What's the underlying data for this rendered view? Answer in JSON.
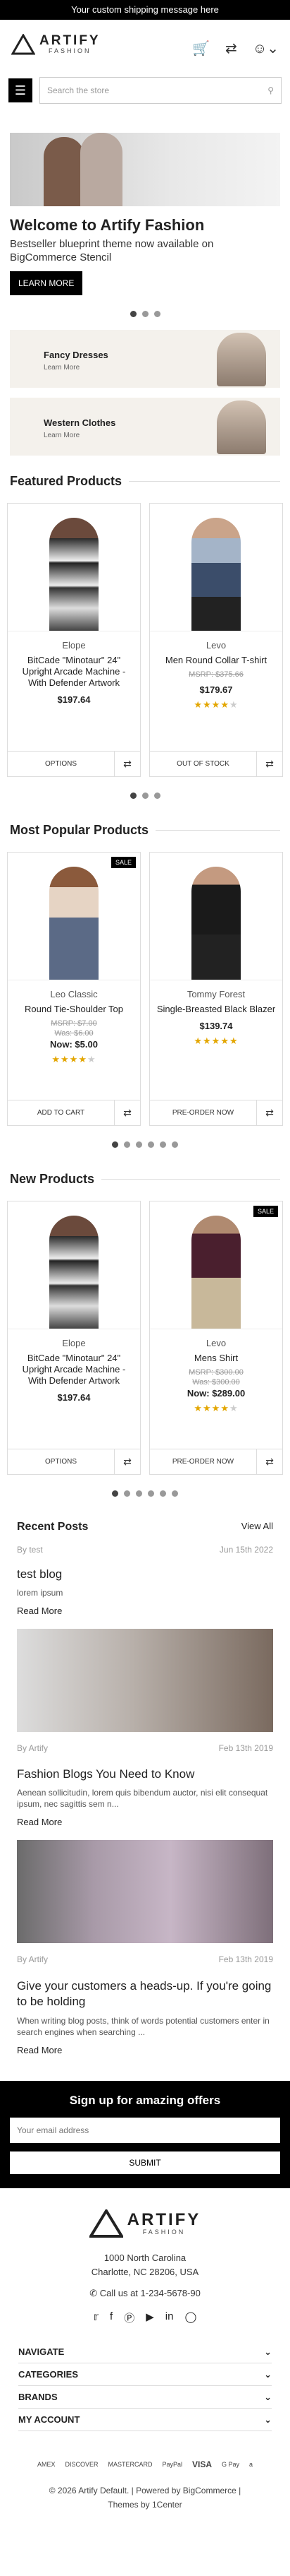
{
  "topbar": {
    "text": "Your custom shipping message here"
  },
  "header": {
    "logo_main": "ARTIFY",
    "logo_sub": "FASHION",
    "cart_icon": "cart-icon",
    "compare_icon": "shuffle-icon",
    "account_icon": "user-icon"
  },
  "search": {
    "placeholder": "Search the store"
  },
  "hero": {
    "title": "Welcome to Artify Fashion",
    "desc": "Bestseller blueprint theme now available on BigCommerce Stencil",
    "button": "LEARN MORE"
  },
  "banners": [
    {
      "title": "Fancy Dresses",
      "link": "Learn More"
    },
    {
      "title": "Western Clothes",
      "link": "Learn More"
    }
  ],
  "featured": {
    "title": "Featured Products",
    "items": [
      {
        "brand": "Elope",
        "name": "BitCade \"Minotaur\" 24\" Upright Arcade Machine - With Defender Artwork",
        "old": "",
        "price": "$197.64",
        "rating": 0,
        "action": "OPTIONS",
        "sale": false
      },
      {
        "brand": "Levo",
        "name": "Men Round Collar T-shirt",
        "old": "MSRP: $375.66",
        "price": "$179.67",
        "rating": 4,
        "action": "OUT OF STOCK",
        "sale": false
      }
    ]
  },
  "popular": {
    "title": "Most Popular Products",
    "items": [
      {
        "brand": "Leo Classic",
        "name": "Round Tie-Shoulder Top",
        "old": "MSRP: $7.00",
        "was": "Was: $6.00",
        "price": "Now: $5.00",
        "rating": 4,
        "action": "ADD TO CART",
        "sale": true
      },
      {
        "brand": "Tommy Forest",
        "name": "Single-Breasted Black Blazer",
        "old": "",
        "was": "",
        "price": "$139.74",
        "rating": 5,
        "action": "PRE-ORDER NOW",
        "sale": false
      }
    ]
  },
  "newp": {
    "title": "New Products",
    "items": [
      {
        "brand": "Elope",
        "name": "BitCade \"Minotaur\" 24\" Upright Arcade Machine - With Defender Artwork",
        "old": "",
        "was": "",
        "price": "$197.64",
        "rating": 0,
        "action": "OPTIONS",
        "sale": false
      },
      {
        "brand": "Levo",
        "name": "Mens Shirt",
        "old": "MSRP: $300.00",
        "was": "Was: $300.00",
        "price": "Now: $289.00",
        "rating": 4,
        "action": "PRE-ORDER NOW",
        "sale": true
      }
    ]
  },
  "recent": {
    "title": "Recent Posts",
    "view_all": "View All",
    "posts": [
      {
        "author": "By test",
        "date": "Jun 15th 2022",
        "title": "test blog",
        "text": "lorem ipsum",
        "read": "Read More"
      },
      {
        "author": "By Artify",
        "date": "Feb 13th 2019",
        "title": "Fashion Blogs You Need to Know",
        "text": "Aenean sollicitudin, lorem quis bibendum auctor, nisi elit consequat ipsum, nec sagittis sem n...",
        "read": "Read More"
      },
      {
        "author": "By Artify",
        "date": "Feb 13th 2019",
        "title": "Give your customers a heads-up. If you're going to be holding",
        "text": "When writing blog posts, think of words potential customers enter in search engines when searching ...",
        "read": "Read More"
      }
    ]
  },
  "signup": {
    "title": "Sign up for amazing offers",
    "placeholder": "Your email address",
    "button": "SUBMIT"
  },
  "footer": {
    "addr1": "1000 North Carolina",
    "addr2": "Charlotte, NC 28206, USA",
    "phone": "Call us at 1-234-5678-90",
    "sections": [
      "NAVIGATE",
      "CATEGORIES",
      "BRANDS",
      "MY ACCOUNT"
    ],
    "payments": [
      "AMEX",
      "DISCOVER",
      "MASTERCARD",
      "PayPal",
      "VISA",
      "G Pay",
      "a"
    ],
    "copy1": "© 2026 Artify Default. | Powered by BigCommerce |",
    "copy2": "Themes by 1Center"
  },
  "colors": {
    "accent": "#000000",
    "star": "#e3a600"
  }
}
